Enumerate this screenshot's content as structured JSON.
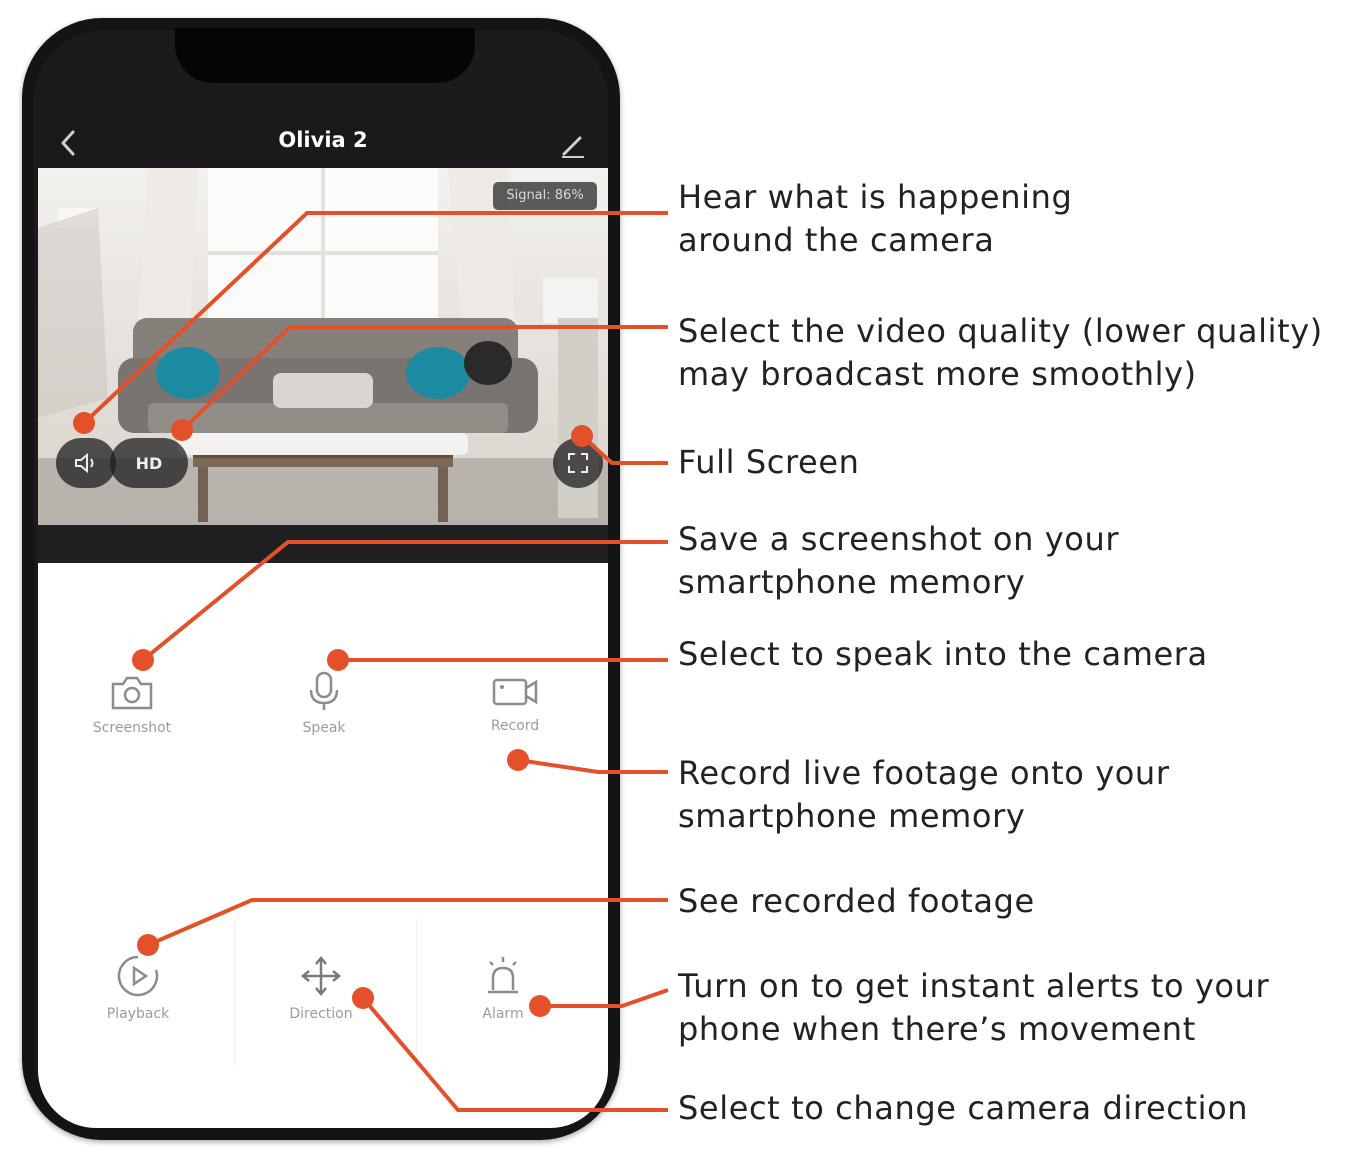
{
  "app": {
    "title": "Olivia 2",
    "back_icon": "chevron-left-icon",
    "edit_icon": "pencil-icon"
  },
  "video": {
    "signal_text": "Signal: 86%",
    "quality_label": "HD",
    "volume_icon": "speaker-icon",
    "fullscreen_icon": "fullscreen-icon"
  },
  "controls": {
    "row1": [
      {
        "label": "Screenshot",
        "icon": "camera-icon"
      },
      {
        "label": "Speak",
        "icon": "microphone-icon"
      },
      {
        "label": "Record",
        "icon": "video-camera-icon"
      }
    ],
    "row2": [
      {
        "label": "Playback",
        "icon": "play-circle-icon"
      },
      {
        "label": "Direction",
        "icon": "move-arrows-icon"
      },
      {
        "label": "Alarm",
        "icon": "siren-icon"
      }
    ]
  },
  "callouts": {
    "hear": [
      "Hear what is happening",
      "around the camera"
    ],
    "quality": [
      "Select the video quality (lower quality)",
      "may broadcast more smoothly)"
    ],
    "fullscreen": [
      "Full Screen"
    ],
    "screenshot": [
      "Save a screenshot on your",
      "smartphone memory"
    ],
    "speak": [
      "Select to speak into the camera"
    ],
    "record": [
      "Record live footage onto your",
      "smartphone memory"
    ],
    "playback": [
      "See recorded footage"
    ],
    "alarm": [
      "Turn on to get instant alerts to your",
      "phone when there’s movement"
    ],
    "direction": [
      "Select to change camera direction"
    ]
  },
  "colors": {
    "accent": "#e4502a",
    "phone": "#141416",
    "header": "#1a1a1d"
  }
}
